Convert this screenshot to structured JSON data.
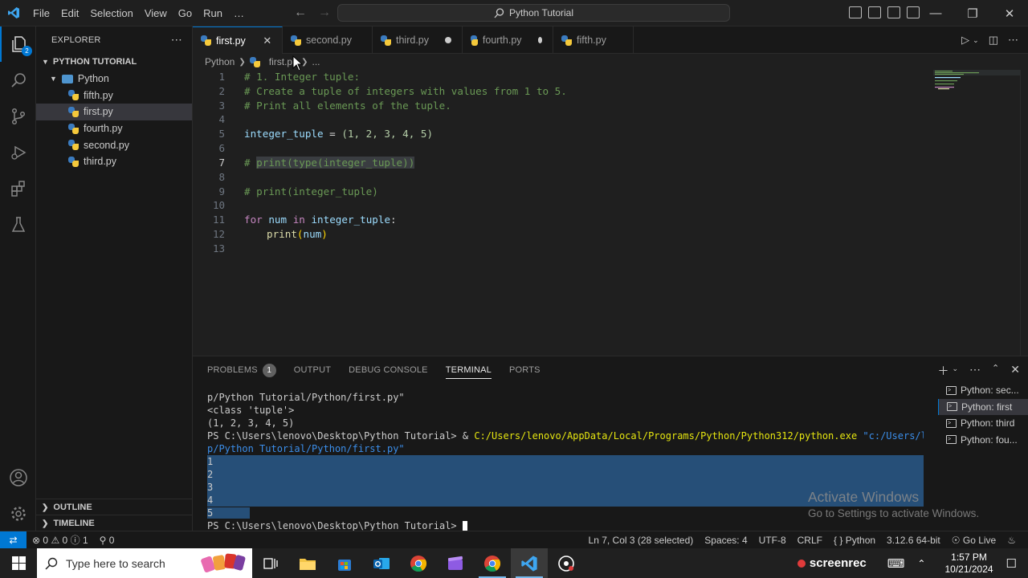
{
  "titlebar": {
    "menus": [
      "File",
      "Edit",
      "Selection",
      "View",
      "Go",
      "Run",
      "…"
    ],
    "search_text": "Python Tutorial"
  },
  "activity": {
    "explorer_badge": "2"
  },
  "sidebar": {
    "title": "EXPLORER",
    "workspace": "PYTHON TUTORIAL",
    "folder": "Python",
    "files": [
      "fifth.py",
      "first.py",
      "fourth.py",
      "second.py",
      "third.py"
    ],
    "outline": "OUTLINE",
    "timeline": "TIMELINE"
  },
  "tabs": [
    {
      "label": "first.py",
      "state": "close"
    },
    {
      "label": "second.py",
      "state": "none"
    },
    {
      "label": "third.py",
      "state": "dirty"
    },
    {
      "label": "fourth.py",
      "state": "dirty"
    },
    {
      "label": "fifth.py",
      "state": "none"
    }
  ],
  "breadcrumb": {
    "folder": "Python",
    "file": "first.py",
    "more": "..."
  },
  "editor": {
    "line_numbers": [
      "1",
      "2",
      "3",
      "4",
      "5",
      "6",
      "7",
      "8",
      "9",
      "10",
      "11",
      "12",
      "13"
    ],
    "l1": "# 1. Integer tuple:",
    "l2": "# Create a tuple of integers with values from 1 to 5.",
    "l3": "# Print all elements of the tuple.",
    "l5_var": "integer_tuple",
    "l5_eq": " = ",
    "l5_val": "(1, 2, 3, 4, 5)",
    "l7_hash": "# ",
    "l7_sel": "print(type(integer_tuple))",
    "l9": "# print(integer_tuple)",
    "l11_for": "for",
    "l11_num": "num",
    "l11_in": "in",
    "l11_iter": "integer_tuple",
    "l11_colon": ":",
    "l12_fn": "print",
    "l12_arg": "num"
  },
  "panel": {
    "tabs": [
      "PROBLEMS",
      "OUTPUT",
      "DEBUG CONSOLE",
      "TERMINAL",
      "PORTS"
    ],
    "problems_count": "1",
    "terminal": {
      "l1": "p/Python Tutorial/Python/first.py\"",
      "l2": "<class 'tuple'>",
      "l3": "(1, 2, 3, 4, 5)",
      "l4_prompt": "PS C:\\Users\\lenovo\\Desktop\\Python Tutorial> & ",
      "l4_exe": "C:/Users/lenovo/AppData/Local/Programs/Python/Python312/python.exe",
      "l4_arg": " \"c:/Users/lenovo/Deskto",
      "l5": "p/Python Tutorial/Python/first.py\"",
      "out": [
        "1",
        "2",
        "3",
        "4",
        "5"
      ],
      "prompt": "PS C:\\Users\\lenovo\\Desktop\\Python Tutorial> "
    },
    "terminals": [
      "Python: sec...",
      "Python: first",
      "Python: third",
      "Python: fou..."
    ],
    "watermark_title": "Activate Windows",
    "watermark_sub": "Go to Settings to activate Windows."
  },
  "statusbar": {
    "errors": "0",
    "warnings": "0",
    "info": "1",
    "ports": "0",
    "position": "Ln 7, Col 3 (28 selected)",
    "spaces": "Spaces: 4",
    "encoding": "UTF-8",
    "eol": "CRLF",
    "language": "Python",
    "interpreter": "3.12.6 64-bit",
    "golive": "Go Live"
  },
  "taskbar": {
    "search_placeholder": "Type here to search",
    "screenrec": "screenrec",
    "time": "1:57 PM",
    "date": "10/21/2024"
  },
  "colors": {
    "accent": "#0078d4",
    "editor_bg": "#1f1f1f",
    "sidebar_bg": "#181818"
  }
}
